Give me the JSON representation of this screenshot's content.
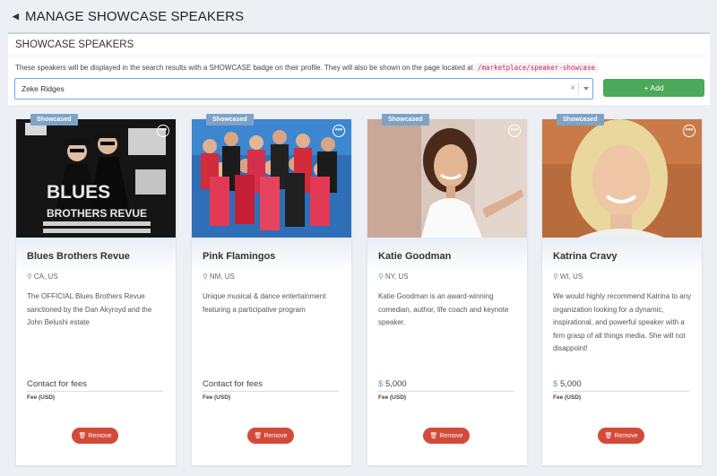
{
  "header": {
    "back_icon": "arrow-left-icon",
    "title": "MANAGE SHOWCASE SPEAKERS"
  },
  "panel": {
    "title": "SHOWCASE SPEAKERS",
    "description": "These speakers will be displayed in the search results with a SHOWCASE badge on their profile. They will also be shown on the page located at",
    "url": "/marketplace/speaker-showcase"
  },
  "select": {
    "value": "Zeke Ridges",
    "clear_label": "×"
  },
  "add_button": {
    "label": "Add",
    "icon": "plus-icon",
    "color": "#4ca85b"
  },
  "speakers": [
    {
      "badge": "Showcased",
      "more": "•••",
      "name": "Blues Brothers Revue",
      "location": "CA, US",
      "description": "The OFFICIAL Blues Brothers Revue sanctioned by the Dan Akyroyd and the John Belushi estate",
      "currency": "",
      "fee": "Contact for fees",
      "fee_label": "Fee (USD)",
      "remove_label": "Remove"
    },
    {
      "badge": "Showcased",
      "more": "•••",
      "name": "Pink Flamingos",
      "location": "NM, US",
      "description": "Unique musical & dance entertainment featuring a participative program",
      "currency": "",
      "fee": "Contact for fees",
      "fee_label": "Fee (USD)",
      "remove_label": "Remove"
    },
    {
      "badge": "Showcased",
      "more": "•••",
      "name": "Katie Goodman",
      "location": "NY, US",
      "description": "Katie Goodman is an award-winning comedian, author, life coach and keynote speaker.",
      "currency": "$",
      "fee": "5,000",
      "fee_label": "Fee (USD)",
      "remove_label": "Remove"
    },
    {
      "badge": "Showcased",
      "more": "•••",
      "name": "Katrina Cravy",
      "location": "WI, US",
      "description": "We would highly recommend Katrina to any organization looking for a dynamic, inspirational, and powerful speaker with a firm grasp of all things media. She will not disappoint!",
      "currency": "$",
      "fee": "5,000",
      "fee_label": "Fee (USD)",
      "remove_label": "Remove"
    }
  ],
  "poster_text": {
    "line1": "BLUES",
    "line2": "BROTHERS REVUE"
  },
  "colors": {
    "badge": "#7ea3c7",
    "remove": "#d44a3a",
    "accent": "#5a9bd4"
  }
}
